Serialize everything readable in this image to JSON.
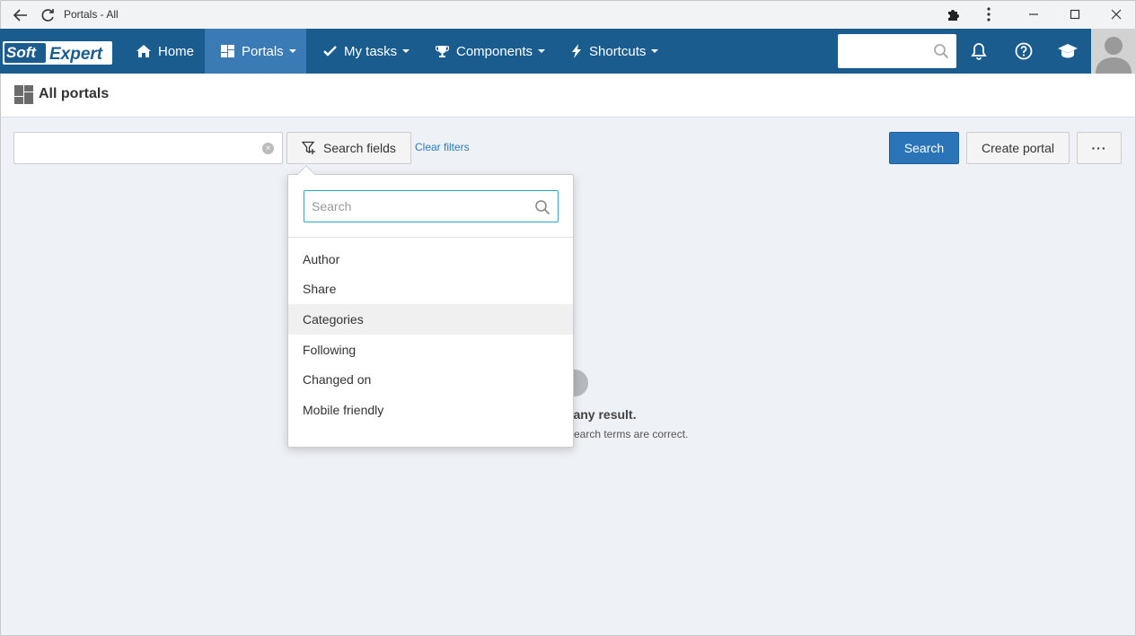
{
  "browser": {
    "tab_title": "Portals - All"
  },
  "nav": {
    "logo_text_1": "Soft",
    "logo_text_2": "Expert",
    "items": [
      {
        "label": "Home",
        "icon": "home-icon"
      },
      {
        "label": "Portals",
        "icon": "portals-grid-icon"
      },
      {
        "label": "My tasks",
        "icon": "check-icon"
      },
      {
        "label": "Components",
        "icon": "trophy-icon"
      },
      {
        "label": "Shortcuts",
        "icon": "bolt-icon"
      }
    ],
    "active_item": "Portals",
    "search_placeholder": ""
  },
  "page": {
    "title": "All portals"
  },
  "toolbar": {
    "filter_value": "",
    "search_fields_label": "Search fields",
    "clear_filters_label": "Clear filters",
    "search_label": "Search",
    "create_label": "Create portal",
    "more_label": "···"
  },
  "dropdown": {
    "search_placeholder": "Search",
    "items": [
      {
        "label": "Author"
      },
      {
        "label": "Share"
      },
      {
        "label": "Categories"
      },
      {
        "label": "Following"
      },
      {
        "label": "Changed on"
      },
      {
        "label": "Mobile friendly"
      }
    ],
    "hovered_item": "Categories"
  },
  "empty_state": {
    "title_visible": "d any result.",
    "subtitle_visible": "search terms are correct."
  },
  "colors": {
    "nav_bg": "#1b5c8f",
    "nav_active": "#3a7ab5",
    "primary_button": "#2b74b8",
    "link": "#2a7ab8",
    "content_bg": "#eef1f6"
  }
}
